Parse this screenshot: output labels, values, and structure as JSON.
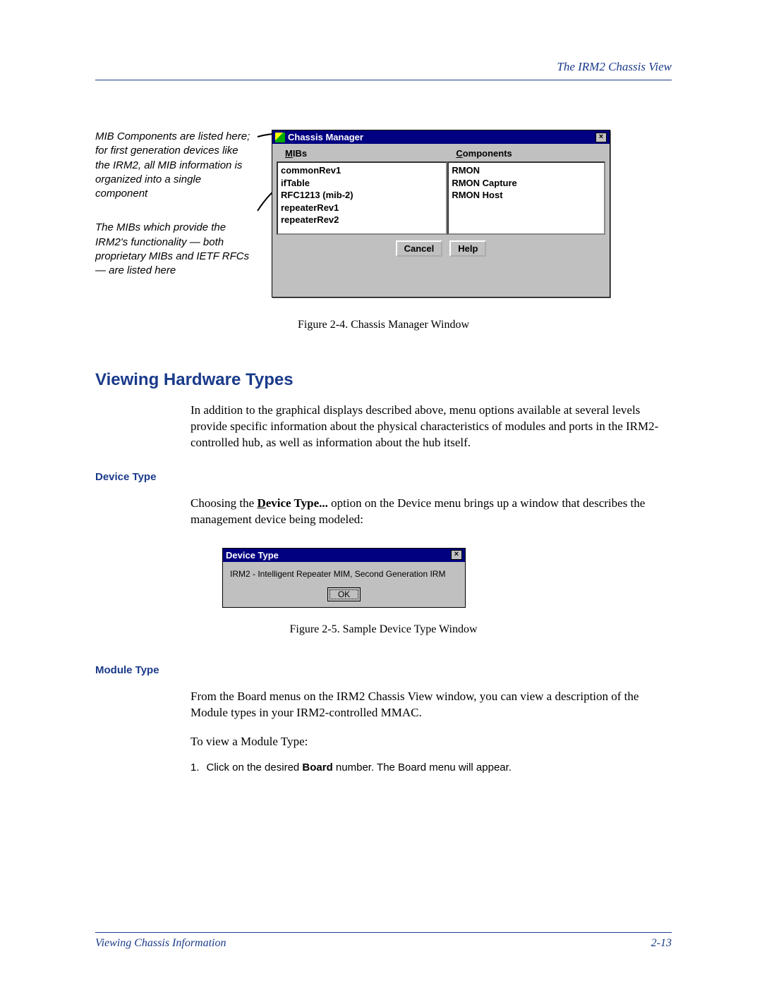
{
  "header": {
    "title": "The IRM2 Chassis View"
  },
  "annotations": {
    "a1": "MIB Components are listed here; for first generation devices like the IRM2, all MIB information is organized into a single component",
    "a2": "The MIBs which provide the IRM2's functionality — both proprietary MIBs and IETF RFCs — are listed here"
  },
  "chassis": {
    "title": "Chassis Manager",
    "col1_label": "MIBs",
    "col2_label": "Components",
    "mibs": [
      "commonRev1",
      "ifTable",
      "RFC1213 (mib-2)",
      "repeaterRev1",
      "repeaterRev2"
    ],
    "components": [
      "RMON",
      "RMON Capture",
      "RMON Host"
    ],
    "cancel": "Cancel",
    "help": "Help"
  },
  "figure1_caption": "Figure 2-4. Chassis Manager Window",
  "section_heading": "Viewing Hardware Types",
  "para1": "In addition to the graphical displays described above, menu options available at several levels provide specific information about the physical characteristics of modules and ports in the IRM2-controlled hub, as well as information about the hub itself.",
  "subsection1": "Device Type",
  "para2_pre": "Choosing the ",
  "para2_bold_u": "D",
  "para2_bold_rest": "evice Type...",
  "para2_post": " option on the Device menu brings up a window that describes the management device being modeled:",
  "device_window": {
    "title": "Device Type",
    "text": "IRM2 - Intelligent Repeater MIM, Second Generation IRM",
    "ok": "OK"
  },
  "figure2_caption": "Figure 2-5. Sample Device Type Window",
  "subsection2": "Module Type",
  "para3": "From the Board menus on the IRM2 Chassis View window, you can view a description of the Module types in your IRM2-controlled MMAC.",
  "para4": "To view a Module Type:",
  "step_num": "1.",
  "step_pre": "Click on the desired ",
  "step_bold": "Board",
  "step_post": " number. The Board menu will appear.",
  "footer": {
    "left": "Viewing Chassis Information",
    "right": "2-13"
  }
}
